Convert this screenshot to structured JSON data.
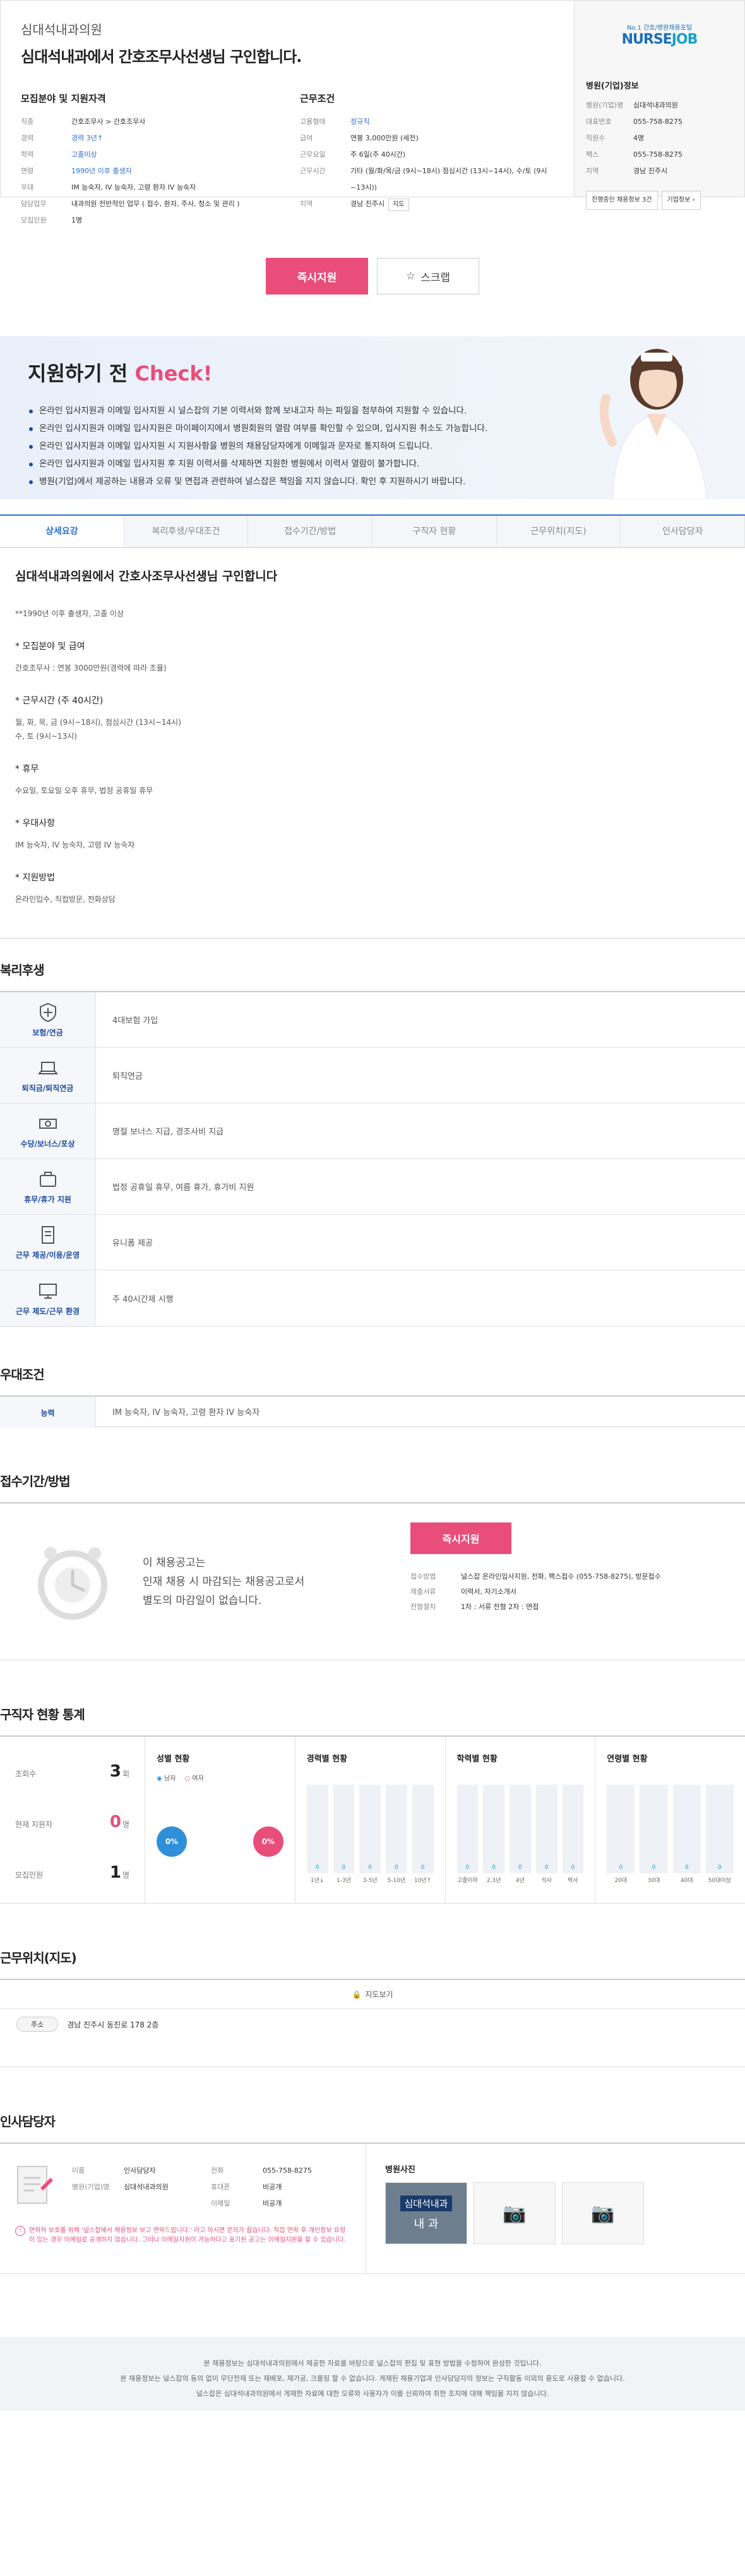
{
  "header": {
    "hospital": "심대석내과의원",
    "title": "심대석내과에서 간호조무사선생님 구인합니다."
  },
  "recruit": {
    "heading": "모집분야 및 지원자격",
    "rows": [
      {
        "k": "직종",
        "v": "간호조무사 > 간호조무사",
        "blue": false
      },
      {
        "k": "경력",
        "v": "경력 3년↑",
        "blue": true
      },
      {
        "k": "학력",
        "v": "고졸이상",
        "blue": true
      },
      {
        "k": "연령",
        "v": "1990년 이후 출생자",
        "blue": true
      },
      {
        "k": "우대",
        "v": "IM 능숙자, IV 능숙자, 고령 환자 IV 능숙자",
        "blue": false
      },
      {
        "k": "담당업무",
        "v": "내과의원 전반적인 업무 ( 접수, 환자, 주사, 청소 및 관리 )",
        "blue": false
      },
      {
        "k": "모집인원",
        "v": "1명",
        "blue": false
      }
    ]
  },
  "work": {
    "heading": "근무조건",
    "rows": [
      {
        "k": "고용형태",
        "v": "정규직",
        "blue": true
      },
      {
        "k": "급여",
        "v": "연봉 3,000만원 (세전)",
        "blue": false
      },
      {
        "k": "근무요일",
        "v": "주 6일(주 40시간)",
        "blue": false
      },
      {
        "k": "근무시간",
        "v": "기타 (월/화/목/금 (9시~18시) 점심시간 (13시~14시), 수/토 (9시~13시))",
        "blue": false
      },
      {
        "k": "지역",
        "v": "경남 진주시",
        "blue": false,
        "btn": "지도"
      }
    ]
  },
  "company": {
    "logo_sub": "No.1 간호/병원채용포털",
    "logo_a": "NURSE",
    "logo_b": "JOB",
    "heading": "병원(기업)정보",
    "rows": [
      {
        "k": "병원(기업)명",
        "v": "심대석내과의원"
      },
      {
        "k": "대표번호",
        "v": "055-758-8275"
      },
      {
        "k": "직원수",
        "v": "4명"
      },
      {
        "k": "팩스",
        "v": "055-758-8275"
      },
      {
        "k": "지역",
        "v": "경남 진주시"
      }
    ],
    "btn1": "진행중인 채용정보 3건",
    "btn2": "기업정보 ›"
  },
  "actions": {
    "apply": "즉시지원",
    "scrap": "스크랩"
  },
  "check": {
    "title": "지원하기 전 ",
    "title_hl": "Check!",
    "items": [
      "온라인 입사지원과 이메일 입사지원 시 널스잡의 기본 이력서와 함께 보내고자 하는 파일을 첨부하여 지원할 수 있습니다.",
      "온라인 입사지원과 이메일 입사지원은 마이페이지에서 병원회원의 열람 여부를 확인할 수 있으며, 입사지원 취소도 가능합니다.",
      "온라인 입사지원과 이메일 입사지원 시 지원사항을 병원의 채용담당자에게 이메일과 문자로 통지하여 드립니다.",
      "온라인 입사지원과 이메일 입사지원 후 지원 이력서를 삭제하면 지원한 병원에서 이력서 열람이 불가합니다.",
      "병원(기업)에서 제공하는 내용과 오류 및 면접과 관련하여 널스잡은 책임을 지지 않습니다. 확인 후 지원하시기 바랍니다."
    ]
  },
  "tabs": [
    "상세요강",
    "복리후생/우대조건",
    "접수기간/방법",
    "구직자 현황",
    "근무위치(지도)",
    "인사담당자"
  ],
  "detail": {
    "title": "심대석내과의원에서 간호사조무사선생님 구인합니다",
    "lines": [
      {
        "t": "l",
        "v": "**1990년 이후 출생자, 고졸 이상"
      },
      {
        "t": "h",
        "v": "* 모집분야 및 급여"
      },
      {
        "t": "l",
        "v": "간호조무사 : 연봉 3000만원(경력에 따라 조율)"
      },
      {
        "t": "h",
        "v": "* 근무시간 (주 40시간)"
      },
      {
        "t": "l",
        "v": "월, 화, 목, 금 (9시~18시), 점심시간 (13시~14시)"
      },
      {
        "t": "l",
        "v": "수, 토 (9시~13시)"
      },
      {
        "t": "h",
        "v": "* 휴무"
      },
      {
        "t": "l",
        "v": "수요일, 토요일 오후 휴무, 법정 공휴일 휴무"
      },
      {
        "t": "h",
        "v": "* 우대사항"
      },
      {
        "t": "l",
        "v": "IM 능숙자, IV 능숙자, 고령 IV 능숙자"
      },
      {
        "t": "h",
        "v": "* 지원방법"
      },
      {
        "t": "l",
        "v": "온라인입수, 직접방문, 전화상담"
      }
    ]
  },
  "benefits": {
    "title": "복리후생",
    "rows": [
      {
        "icon": "shield-icon",
        "k": "보험/연금",
        "v": "4대보험 가입"
      },
      {
        "icon": "laptop-icon",
        "k": "퇴직금/퇴직연금",
        "v": "퇴직연금"
      },
      {
        "icon": "money-icon",
        "k": "수당/보너스/포상",
        "v": "명절 보너스 지급, 경조사비 지급"
      },
      {
        "icon": "suitcase-icon",
        "k": "휴무/휴가 지원",
        "v": "법정 공휴일 휴무, 여름 휴가, 휴가비 지원"
      },
      {
        "icon": "document-icon",
        "k": "근무 제공/이용/운영",
        "v": "유니폼 제공"
      },
      {
        "icon": "monitor-icon",
        "k": "근무 제도/근무 환경",
        "v": "주 40시간제 시행"
      }
    ]
  },
  "preference": {
    "title": "우대조건",
    "k": "능력",
    "v": "IM 능숙자, IV 능숙자, 고령 환자 IV 능숙자"
  },
  "reception": {
    "title": "접수기간/방법",
    "msg1": "이 채용공고는",
    "msg2": "인재 채용 시 마감되는 채용공고로서",
    "msg3": "별도의 마감일이 없습니다.",
    "apply": "즉시지원",
    "rows": [
      {
        "k": "접수방법",
        "v": "널스잡 온라인입사지원, 전화, 팩스접수 (055-758-8275), 방문접수"
      },
      {
        "k": "제출서류",
        "v": "이력서, 자기소개서"
      },
      {
        "k": "전형절차",
        "v": "1차 : 서류 전형   2차 : 면접"
      }
    ]
  },
  "stats": {
    "title": "구직자 현황 통계",
    "summary": [
      {
        "k": "조회수",
        "v": "3",
        "u": "회",
        "red": false
      },
      {
        "k": "현재 지원자",
        "v": "0",
        "u": "명",
        "red": true
      },
      {
        "k": "모집인원",
        "v": "1",
        "u": "명",
        "red": false
      }
    ],
    "gender": {
      "title": "성별 현황",
      "male": "남자",
      "female": "여자",
      "male_pct": "0%",
      "female_pct": "0%"
    },
    "career": {
      "title": "경력별 현황",
      "bars": [
        {
          "l": "1년↓",
          "v": "0"
        },
        {
          "l": "1-3년",
          "v": "0"
        },
        {
          "l": "3-5년",
          "v": "0"
        },
        {
          "l": "5-10년",
          "v": "0"
        },
        {
          "l": "10년↑",
          "v": "0"
        }
      ]
    },
    "edu": {
      "title": "학력별 현황",
      "bars": [
        {
          "l": "고졸이하",
          "v": "0"
        },
        {
          "l": "2,3년",
          "v": "0"
        },
        {
          "l": "4년",
          "v": "0"
        },
        {
          "l": "석사",
          "v": "0"
        },
        {
          "l": "박사",
          "v": "0"
        }
      ]
    },
    "age": {
      "title": "연령별 현황",
      "bars": [
        {
          "l": "20대",
          "v": "0"
        },
        {
          "l": "30대",
          "v": "0"
        },
        {
          "l": "40대",
          "v": "0"
        },
        {
          "l": "50대이상",
          "v": "0"
        }
      ]
    }
  },
  "location": {
    "title": "근무위치(지도)",
    "map_btn": "지도보기",
    "addr_k": "주소",
    "addr": "경남 진주시 동진로 178 2층"
  },
  "manager": {
    "title": "인사담당자",
    "rows_a": [
      {
        "k": "이름",
        "v": "인사담당자"
      },
      {
        "k": "병원(기업)명",
        "v": "심대석내과의원"
      }
    ],
    "rows_b": [
      {
        "k": "전화",
        "v": "055-758-8275"
      },
      {
        "k": "휴대폰",
        "v": "비공개"
      },
      {
        "k": "이메일",
        "v": "비공개"
      }
    ],
    "warn": "연락처 보호를 위해 '널스잡에서 채용정보 보고 연락드립니다.' 라고 하시면 문의가 쉽습니다. 직접 연락 후 개인정보 요청이 있는 경우 이메일로 공개하지 않습니다. 그러나 이메일지원이 가능하다고 표기된 공고는 이메일지원을 할 수 있습니다.",
    "photo_title": "병원사진",
    "photo_sign": "심대석내과",
    "photo_sign2": "내 과"
  },
  "footer": [
    "본 채용정보는 심대석내과의원에서 제공한 자료를 바탕으로 널스잡의 편집 및 표현 방법을 수정하여 완성한 것입니다.",
    "본 채용정보는 널스잡의 동의 없이 무단전재 또는 재배포, 재가공, 크롤링 할 수 없습니다. 게재된 채용기업과 인사담당자의 정보는 구직활동 이외의 용도로 사용할 수 없습니다.",
    "널스잡은 심대석내과의원에서 게재한 자료에 대한 오류와 사용자가 이를 신뢰하여 취한 조치에 대해 책임을 지지 않습니다."
  ],
  "colors": {
    "accent": "#2f6fd1",
    "pink": "#e94d7a",
    "navy": "#1b4aa0"
  }
}
